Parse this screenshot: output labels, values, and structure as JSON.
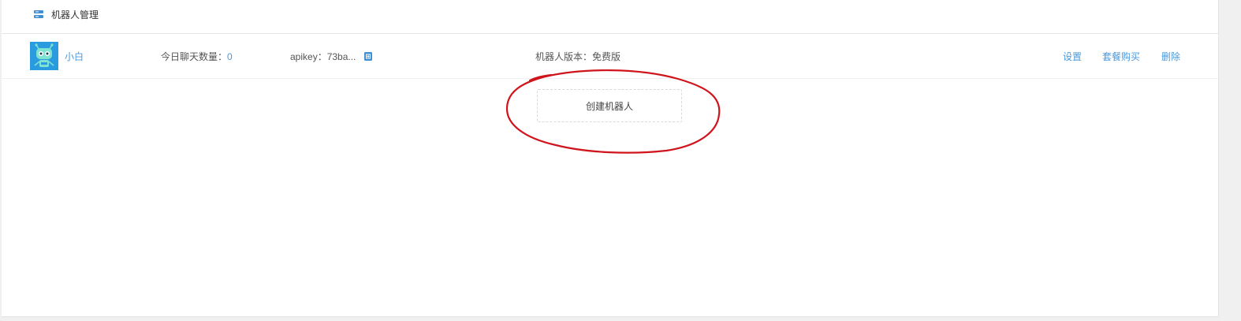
{
  "header": {
    "icon": "server-icon",
    "title": "机器人管理"
  },
  "robot": {
    "avatar_icon": "robot-avatar",
    "name": "小白",
    "chat_label": "今日聊天数量：",
    "chat_count": "0",
    "apikey": "apikey：73ba...",
    "copy_icon": "copy-icon",
    "version": "机器人版本：免费版",
    "actions": {
      "settings": "设置",
      "package": "套餐购买",
      "delete": "删除"
    }
  },
  "create": {
    "label": "创建机器人"
  },
  "colors": {
    "accent": "#4a98d8",
    "annotation": "#d0141c"
  }
}
